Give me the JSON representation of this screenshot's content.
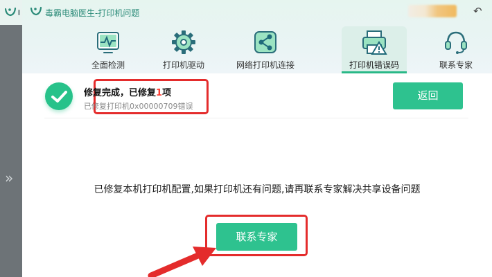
{
  "app": {
    "title": "毒霸电脑医生-打印机问题",
    "back_glyph": "↶"
  },
  "sidebar": {
    "expand_glyph": "»"
  },
  "nav": {
    "tabs": [
      {
        "label": "全面检测",
        "icon": "monitor-pulse-icon",
        "active": false
      },
      {
        "label": "打印机驱动",
        "icon": "gear-icon",
        "active": false
      },
      {
        "label": "网络打印机连接",
        "icon": "share-icon",
        "active": false
      },
      {
        "label": "打印机错误码",
        "icon": "printer-warning-icon",
        "active": true
      },
      {
        "label": "联系专家",
        "icon": "headset-icon",
        "active": false
      }
    ]
  },
  "result": {
    "title_prefix": "修复完成，已修复",
    "count": "1",
    "title_suffix": "项",
    "detail": "已修复打印机0x00000709错误",
    "return_label": "返回"
  },
  "main": {
    "message": "已修复本机打印机配置,如果打印机还有问题,请再联系专家解决共享设备问题",
    "contact_label": "联系专家"
  },
  "colors": {
    "accent": "#2ec28f",
    "highlight": "#e42c2c",
    "count": "#ff3b30"
  }
}
